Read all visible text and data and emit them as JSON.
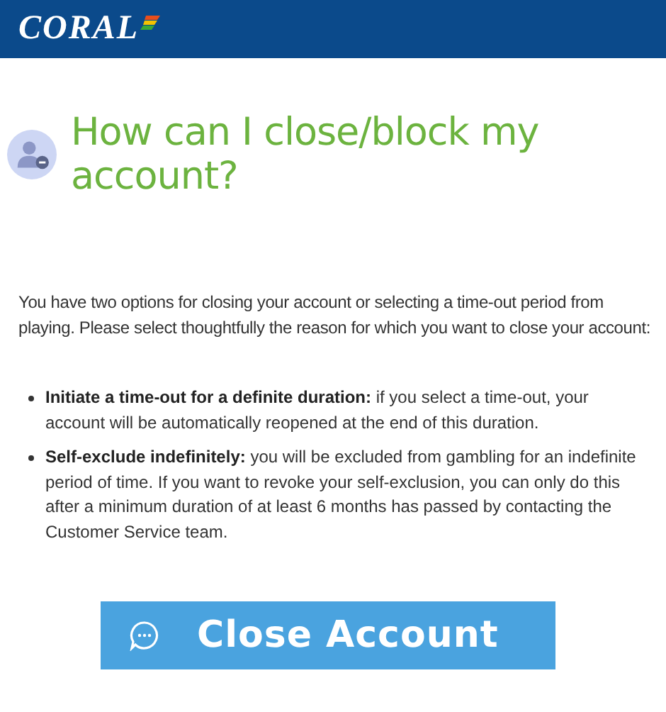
{
  "header": {
    "logo": "CORAL"
  },
  "title": "How can I close/block my account?",
  "intro": "You have two options for closing your account or selecting a time-out period from playing. Please select thoughtfully the reason for which you want to close your account:",
  "options": [
    {
      "text": "**Initiate a time-out for a definite duration:** if you select a time-out, your account will be automatically reopened at the end of this duration."
    },
    {
      "text": "**Self-exclude indefinitely:** you will be excluded from gambling for an indefinite period of time. If you want to revoke your self-exclusion, you can only do this after a minimum duration of at least 6 months has passed by contacting the Customer Service team."
    }
  ],
  "button": {
    "label": "Close Account"
  }
}
